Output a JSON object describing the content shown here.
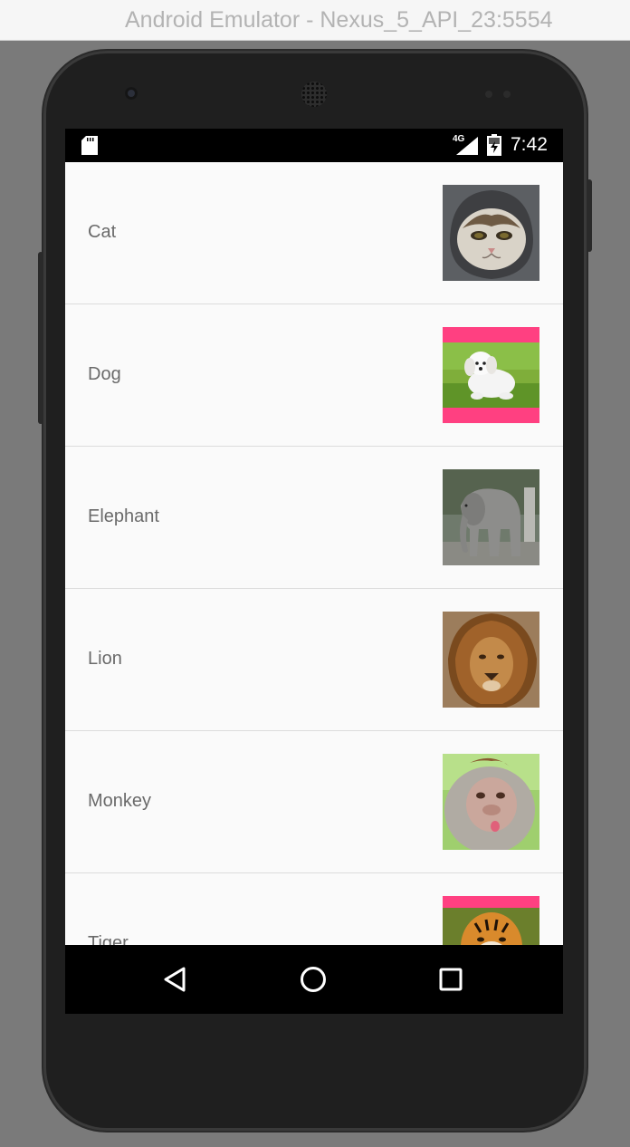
{
  "window": {
    "title": "Android Emulator - Nexus_5_API_23:5554"
  },
  "status_bar": {
    "network_label": "4G",
    "time": "7:42",
    "icons": [
      "sd-card-icon",
      "signal-icon",
      "battery-icon"
    ]
  },
  "animal_list": {
    "items": [
      {
        "label": "Cat",
        "image": "cat-photo"
      },
      {
        "label": "Dog",
        "image": "dog-photo"
      },
      {
        "label": "Elephant",
        "image": "elephant-photo"
      },
      {
        "label": "Lion",
        "image": "lion-photo"
      },
      {
        "label": "Monkey",
        "image": "monkey-photo"
      },
      {
        "label": "Tiger",
        "image": "tiger-photo"
      }
    ]
  },
  "nav_bar": {
    "buttons": [
      "back-icon",
      "home-icon",
      "recent-apps-icon"
    ]
  },
  "colors": {
    "accent_pink": "#ff4081",
    "list_background": "#fafafa",
    "label_text": "#6a6a6a",
    "divider": "#dcdcdc"
  }
}
